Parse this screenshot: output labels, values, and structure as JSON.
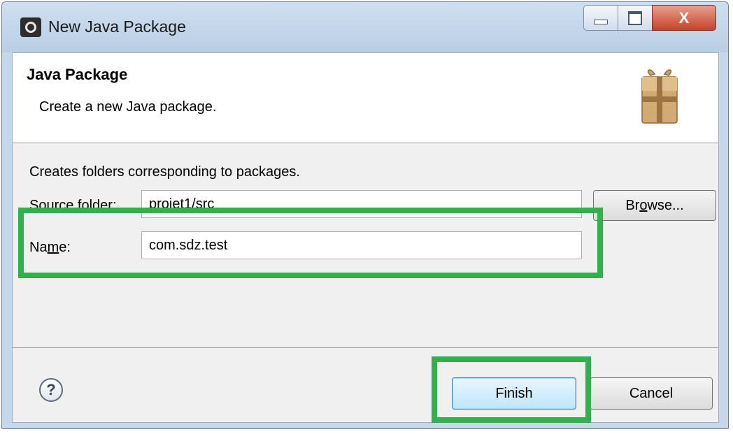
{
  "window": {
    "title": "New Java Package",
    "controls": {
      "minimize": "—",
      "maximize": "□",
      "close": "X"
    }
  },
  "header": {
    "title": "Java Package",
    "description": "Create a new Java package."
  },
  "form": {
    "intro": "Creates folders corresponding to packages.",
    "source_folder": {
      "label_pre": "Source folder:",
      "value": "projet1/src"
    },
    "browse_button": {
      "pre": "Br",
      "mnemonic": "o",
      "post": "wse..."
    },
    "name": {
      "label_pre": "Na",
      "label_mnemonic": "m",
      "label_post": "e:",
      "value": "com.sdz.test"
    }
  },
  "footer": {
    "help": "?",
    "finish_button": "Finish",
    "cancel_button": "Cancel"
  },
  "colors": {
    "highlight": "#2fb24c",
    "default_button": "#bee6fd",
    "close_button": "#c4422a"
  },
  "icons": [
    "eclipse-app-icon",
    "package-icon",
    "help-icon"
  ]
}
